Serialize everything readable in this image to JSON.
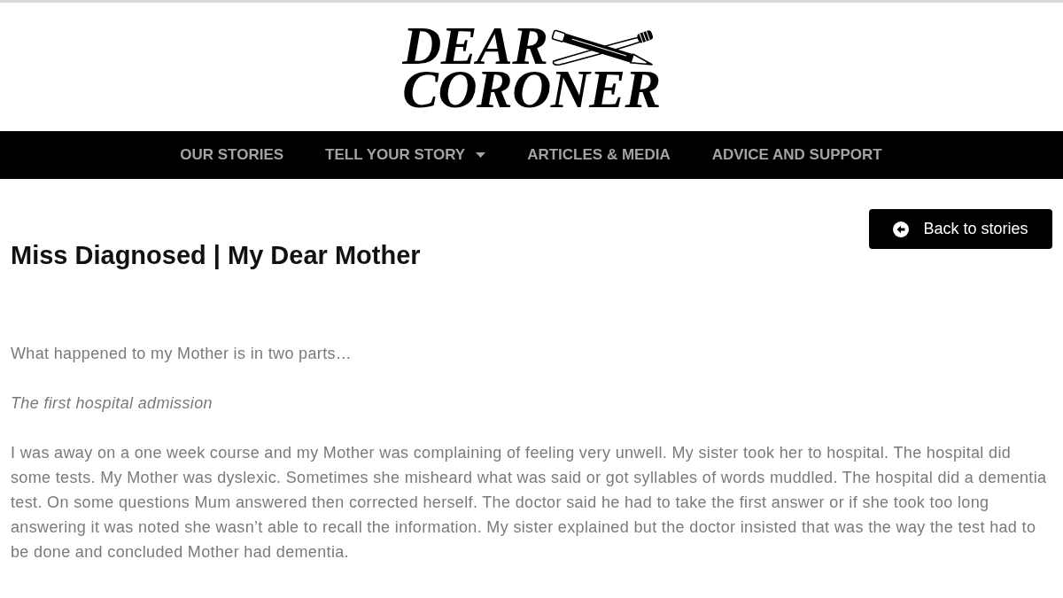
{
  "logo": {
    "lines": [
      "DEAR",
      "CORONER"
    ]
  },
  "nav": {
    "items": [
      {
        "label": "OUR STORIES",
        "dropdown": false
      },
      {
        "label": "TELL YOUR STORY",
        "dropdown": true
      },
      {
        "label": "ARTICLES & MEDIA",
        "dropdown": false
      },
      {
        "label": "ADVICE AND SUPPORT",
        "dropdown": false
      }
    ]
  },
  "back_button": {
    "label": "Back to stories"
  },
  "article": {
    "title": "Miss Diagnosed | My Dear Mother",
    "paragraphs": [
      {
        "kind": "plain",
        "text": "What happened to my Mother is in two parts…"
      },
      {
        "kind": "italic",
        "text": "The first hospital admission"
      },
      {
        "kind": "plain",
        "text": "I was away on a one week course and my Mother was complaining of feeling very unwell. My sister took her to hospital. The hospital did some tests. My Mother was dyslexic. Sometimes she misheard what was said or got syllables of words muddled. The hospital did a dementia test. On some questions Mum answered then corrected herself. The doctor said he had to take the first answer or if she took too long answering it was noted she wasn’t able to recall the information. My sister explained but the doctor insisted that was the way the test had to be done and concluded Mother had dementia."
      }
    ]
  }
}
